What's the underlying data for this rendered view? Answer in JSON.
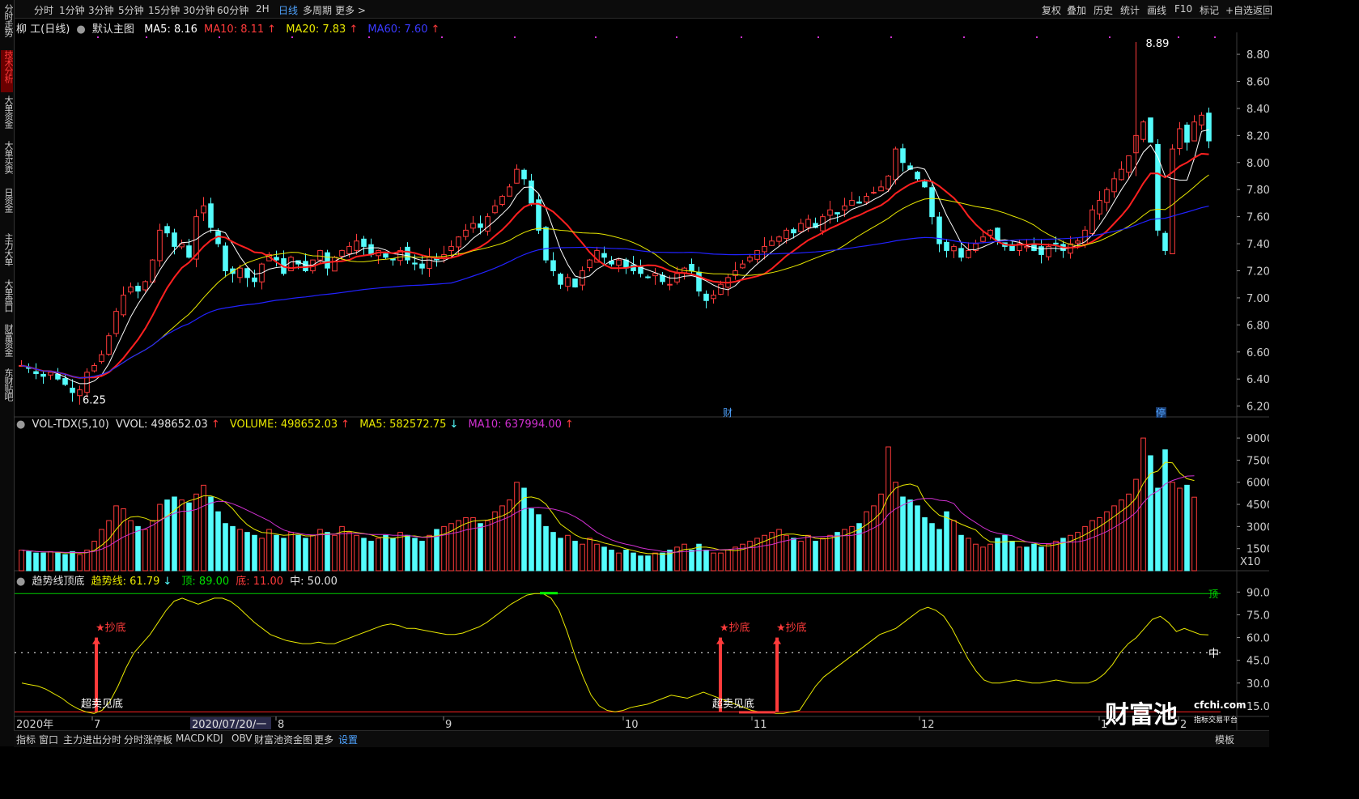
{
  "top_tabs": [
    {
      "label": "分时"
    },
    {
      "label": "1分钟"
    },
    {
      "label": "3分钟"
    },
    {
      "label": "5分钟"
    },
    {
      "label": "15分钟"
    },
    {
      "label": "30分钟"
    },
    {
      "label": "60分钟"
    },
    {
      "label": "2H"
    },
    {
      "label": "日线",
      "active": true
    },
    {
      "label": "多周期"
    },
    {
      "label": "更多 >"
    }
  ],
  "right_tabs": [
    "复权",
    "叠加",
    "历史",
    "统计",
    "画线",
    "F10",
    "标记",
    "+自选",
    "返回"
  ],
  "sidebar": [
    "分时走势",
    "技术分析",
    "大单资金",
    "大单买卖",
    "日资金",
    "主力大单",
    "大单盘口",
    "财富资金",
    "东财贴吧"
  ],
  "main_legend": {
    "title": "柳 工(日线)",
    "template": "默认主图",
    "ma5": "MA5: 8.16",
    "ma10": "MA10: 8.11",
    "ma20": "MA20: 7.83",
    "ma60": "MA60: 7.60",
    "up_arrow": "↑"
  },
  "vol_legend": {
    "title": "VOL-TDX(5,10)",
    "vvol": "VVOL: 498652.03",
    "volume": "VOLUME: 498652.03",
    "ma5": "MA5: 582572.75",
    "ma10": "MA10: 637994.00",
    "up_arrow": "↑",
    "down_arrow": "↓"
  },
  "trend_legend": {
    "title": "趋势线顶底",
    "trend": "趋势线: 61.79",
    "top": "顶: 89.00",
    "bottom": "底: 11.00",
    "mid": "中: 50.00",
    "down_arrow": "↓"
  },
  "markers": {
    "high": "8.89",
    "low": "6.25",
    "cai": "财",
    "ting": "停",
    "chaodi": "★抄底",
    "chaomai": "超卖见底",
    "ding": "顶",
    "zhong": "中"
  },
  "x_axis": {
    "year": "2020年",
    "cursor_date": "2020/07/20/一",
    "labels": [
      "7",
      "8",
      "9",
      "10",
      "11",
      "12",
      "1",
      "2"
    ]
  },
  "bottom_tabs": [
    "指标",
    "窗口",
    "主力进出分时",
    "分时涨停板",
    "MACD",
    "KDJ",
    "OBV",
    "财富池资金图",
    "更多",
    "设置"
  ],
  "bottom_right": "模板",
  "logo": {
    "brand": "财富池",
    "site": "cfchi.com",
    "slogan": "指标交易平台"
  },
  "colors": {
    "up": "#ff3b3b",
    "down": "#54fcfc",
    "ma5": "#ffffff",
    "ma10": "#ff2020",
    "ma20": "#e8e800",
    "ma60": "#2222ff",
    "vol_ma5": "#e8e800",
    "vol_ma10": "#d030d0",
    "trend": "#e8e800",
    "top_line": "#00cc00",
    "bottom_line": "#ff2020"
  },
  "chart_data": [
    {
      "type": "candlestick",
      "title": "柳 工(日线)",
      "y_ticks": [
        8.8,
        8.6,
        8.4,
        8.2,
        8.0,
        7.8,
        7.6,
        7.4,
        7.2,
        7.0,
        6.8,
        6.6,
        6.4,
        6.2
      ],
      "ylim": [
        6.15,
        8.95
      ],
      "x_labels": [
        "7",
        "8",
        "9",
        "10",
        "11",
        "12",
        "1",
        "2"
      ],
      "highest": 8.89,
      "lowest": 6.25,
      "closes": [
        6.5,
        6.48,
        6.44,
        6.42,
        6.45,
        6.4,
        6.36,
        6.3,
        6.32,
        6.45,
        6.5,
        6.58,
        6.72,
        6.9,
        7.02,
        7.08,
        7.05,
        7.12,
        7.28,
        7.5,
        7.48,
        7.38,
        7.4,
        7.3,
        7.6,
        7.68,
        7.52,
        7.4,
        7.2,
        7.18,
        7.22,
        7.15,
        7.12,
        7.25,
        7.32,
        7.28,
        7.18,
        7.3,
        7.25,
        7.2,
        7.28,
        7.35,
        7.22,
        7.3,
        7.35,
        7.38,
        7.42,
        7.38,
        7.32,
        7.35,
        7.3,
        7.28,
        7.35,
        7.28,
        7.25,
        7.22,
        7.3,
        7.28,
        7.32,
        7.38,
        7.45,
        7.5,
        7.55,
        7.52,
        7.6,
        7.68,
        7.75,
        7.82,
        7.95,
        7.88,
        7.7,
        7.5,
        7.28,
        7.2,
        7.1,
        7.15,
        7.08,
        7.2,
        7.28,
        7.35,
        7.3,
        7.25,
        7.28,
        7.22,
        7.2,
        7.18,
        7.15,
        7.18,
        7.12,
        7.1,
        7.18,
        7.22,
        7.2,
        7.05,
        6.98,
        7.02,
        7.1,
        7.15,
        7.2,
        7.25,
        7.3,
        7.35,
        7.38,
        7.42,
        7.45,
        7.5,
        7.48,
        7.55,
        7.58,
        7.52,
        7.6,
        7.65,
        7.62,
        7.68,
        7.72,
        7.7,
        7.75,
        7.78,
        7.82,
        7.9,
        8.1,
        8.0,
        7.95,
        7.88,
        7.82,
        7.6,
        7.4,
        7.35,
        7.38,
        7.3,
        7.35,
        7.4,
        7.45,
        7.5,
        7.42,
        7.38,
        7.35,
        7.4,
        7.38,
        7.35,
        7.32,
        7.38,
        7.4,
        7.35,
        7.4,
        7.42,
        7.5,
        7.65,
        7.72,
        7.8,
        7.88,
        7.95,
        8.05,
        8.2,
        8.3,
        8.15,
        7.5,
        7.35,
        8.1,
        8.25,
        8.15,
        8.3,
        8.35,
        8.16
      ]
    },
    {
      "type": "bar",
      "title": "VOL-TDX(5,10)",
      "y_ticks": [
        90000,
        75000,
        60000,
        45000,
        30000,
        15000
      ],
      "y_unit": "X10",
      "ylim": [
        0,
        95000
      ],
      "values": [
        14000,
        13000,
        12000,
        12000,
        13000,
        12000,
        11000,
        13000,
        11000,
        14000,
        20000,
        28000,
        34000,
        44000,
        42000,
        34000,
        30000,
        28000,
        34000,
        45000,
        48000,
        50000,
        48000,
        46000,
        52000,
        58000,
        50000,
        40000,
        32000,
        30000,
        28000,
        26000,
        24000,
        22000,
        28000,
        24000,
        22000,
        26000,
        24000,
        22000,
        24000,
        28000,
        26000,
        24000,
        30000,
        26000,
        24000,
        22000,
        20000,
        22000,
        24000,
        22000,
        26000,
        24000,
        22000,
        20000,
        24000,
        28000,
        30000,
        32000,
        34000,
        36000,
        36000,
        32000,
        34000,
        40000,
        44000,
        48000,
        60000,
        56000,
        42000,
        38000,
        30000,
        26000,
        22000,
        24000,
        20000,
        18000,
        22000,
        18000,
        16000,
        14000,
        12000,
        14000,
        12000,
        10000,
        10000,
        12000,
        12000,
        14000,
        16000,
        18000,
        14000,
        18000,
        14000,
        12000,
        12000,
        14000,
        16000,
        18000,
        20000,
        22000,
        24000,
        26000,
        28000,
        24000,
        22000,
        20000,
        24000,
        20000,
        22000,
        24000,
        26000,
        28000,
        30000,
        32000,
        40000,
        44000,
        52000,
        84000,
        60000,
        50000,
        48000,
        44000,
        36000,
        32000,
        28000,
        40000,
        34000,
        24000,
        22000,
        18000,
        16000,
        18000,
        22000,
        24000,
        20000,
        16000,
        16000,
        18000,
        16000,
        18000,
        20000,
        22000,
        24000,
        26000,
        30000,
        34000,
        36000,
        40000,
        44000,
        48000,
        52000,
        62000,
        90000,
        78000,
        56000,
        82000,
        60000,
        56000,
        58000,
        49865
      ]
    },
    {
      "type": "line",
      "title": "趋势线顶底",
      "y_ticks": [
        90.0,
        75.0,
        60.0,
        45.0,
        30.0,
        15.0
      ],
      "ylim": [
        8,
        95
      ],
      "top": 89.0,
      "bottom": 11.0,
      "mid": 50.0,
      "values": [
        30,
        29,
        28,
        26,
        23,
        20,
        16,
        13,
        11,
        10,
        12,
        18,
        28,
        40,
        50,
        56,
        62,
        70,
        78,
        84,
        86,
        84,
        82,
        84,
        86,
        86,
        84,
        80,
        75,
        70,
        66,
        62,
        60,
        58,
        57,
        56,
        56,
        57,
        56,
        56,
        58,
        60,
        62,
        64,
        66,
        68,
        69,
        68,
        66,
        66,
        65,
        64,
        63,
        62,
        62,
        63,
        65,
        67,
        70,
        74,
        78,
        82,
        85,
        88,
        89,
        89,
        86,
        78,
        64,
        48,
        34,
        22,
        15,
        12,
        11,
        12,
        14,
        15,
        16,
        18,
        20,
        22,
        21,
        20,
        22,
        24,
        22,
        20,
        18,
        16,
        14,
        12,
        11,
        11,
        10,
        10,
        11,
        12,
        20,
        28,
        34,
        38,
        42,
        46,
        50,
        54,
        58,
        62,
        64,
        66,
        70,
        74,
        78,
        80,
        78,
        74,
        66,
        56,
        46,
        38,
        32,
        30,
        30,
        31,
        32,
        31,
        30,
        30,
        31,
        32,
        31,
        30,
        30,
        30,
        32,
        36,
        42,
        50,
        56,
        60,
        66,
        72,
        74,
        70,
        64,
        66,
        64,
        62,
        61.79
      ]
    }
  ]
}
